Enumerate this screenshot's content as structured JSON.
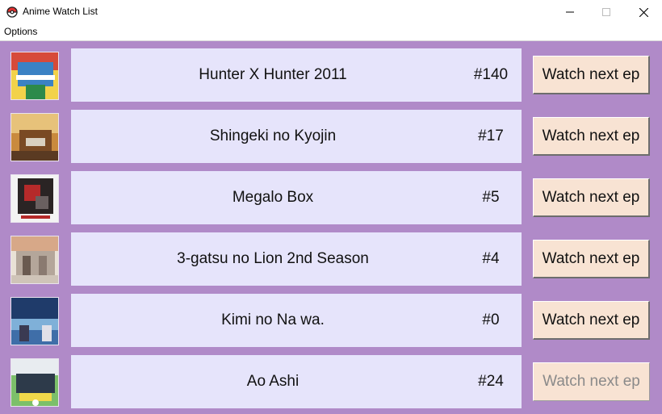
{
  "window": {
    "title": "Anime Watch List",
    "app_icon": "pokeball-icon",
    "controls": [
      "minimize-icon",
      "maximize-icon",
      "close-icon"
    ]
  },
  "menu": {
    "options_label": "Options"
  },
  "colors": {
    "background": "#b08ac8",
    "card": "#e6e4fb",
    "button": "#f8e3d3"
  },
  "list": [
    {
      "title": "Hunter X Hunter 2011",
      "episode": "#140",
      "button": "Watch next ep",
      "button_enabled": true
    },
    {
      "title": "Shingeki no Kyojin",
      "episode": "#17",
      "button": "Watch next ep",
      "button_enabled": true
    },
    {
      "title": "Megalo Box",
      "episode": "#5",
      "button": "Watch next ep",
      "button_enabled": true
    },
    {
      "title": "3-gatsu no Lion 2nd Season",
      "episode": "#4",
      "button": "Watch next ep",
      "button_enabled": true
    },
    {
      "title": "Kimi no Na wa.",
      "episode": "#0",
      "button": "Watch next ep",
      "button_enabled": true
    },
    {
      "title": "Ao Ashi",
      "episode": "#24",
      "button": "Watch next ep",
      "button_enabled": false
    }
  ]
}
